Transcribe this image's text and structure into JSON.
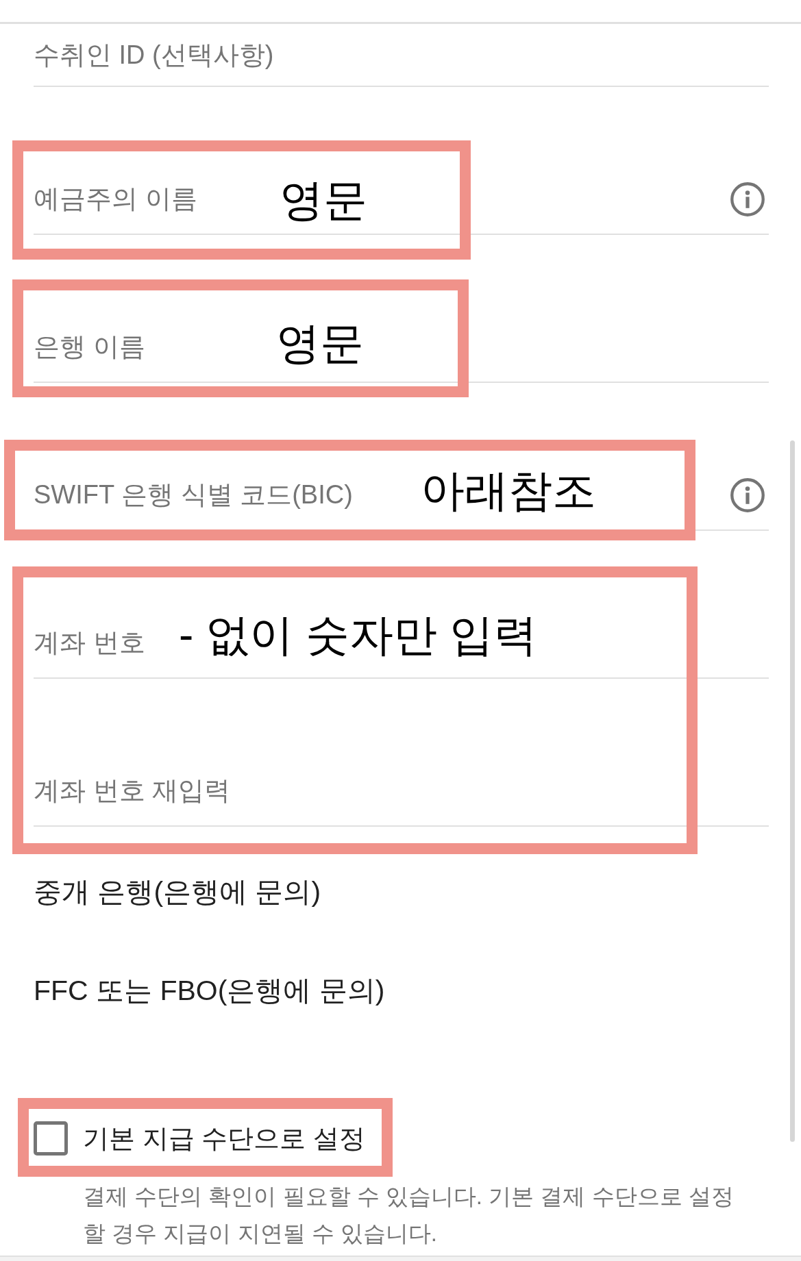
{
  "fields": [
    {
      "placeholder": "수취인 ID (선택사항)",
      "info": false
    },
    {
      "placeholder": "예금주의 이름",
      "info": true
    },
    {
      "placeholder": "은행 이름",
      "info": false
    },
    {
      "placeholder": "SWIFT 은행 식별 코드(BIC)",
      "info": true
    },
    {
      "placeholder": "계좌 번호",
      "info": false
    },
    {
      "placeholder": "계좌 번호 재입력",
      "info": false
    }
  ],
  "links": [
    {
      "label": "중개 은행(은행에 문의)"
    },
    {
      "label": "FFC 또는 FBO(은행에 문의)"
    }
  ],
  "default_checkbox": {
    "label": "기본 지급 수단으로 설정",
    "checked": false,
    "helper": "결제 수단의 확인이 필요할 수 있습니다. 기본 결제 수단으로 설정할 경우 지급이 지연될 수 있습니다."
  },
  "annotations": [
    {
      "kind": "note",
      "note": "영문"
    },
    {
      "kind": "note",
      "note": "영문"
    },
    {
      "kind": "note",
      "note": "아래참조"
    },
    {
      "kind": "note",
      "note": "- 없이 숫자만 입력"
    },
    {
      "kind": "frame"
    }
  ]
}
